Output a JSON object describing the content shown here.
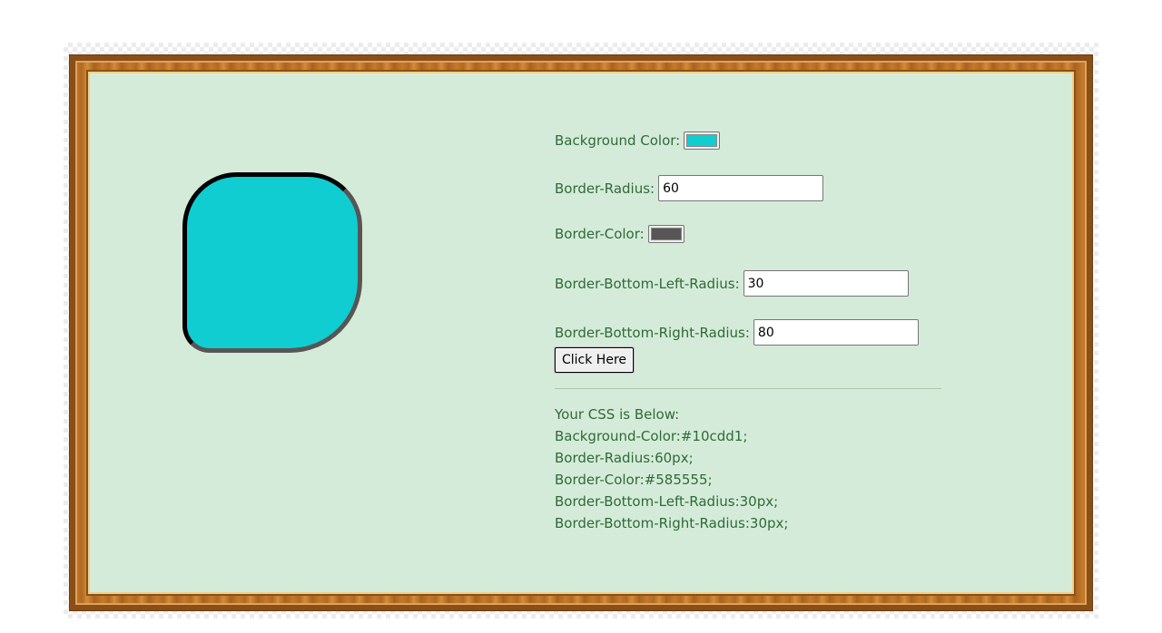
{
  "controls": {
    "background_color": {
      "label": "Background Color:",
      "value": "#10cdd1"
    },
    "border_radius": {
      "label": "Border-Radius:",
      "value": "60"
    },
    "border_color": {
      "label": "Border-Color:",
      "value": "#585555"
    },
    "border_bottom_left_radius": {
      "label": "Border-Bottom-Left-Radius:",
      "value": "30"
    },
    "border_bottom_right_radius": {
      "label": "Border-Bottom-Right-Radius:",
      "value": "80"
    },
    "submit_label": "Click Here"
  },
  "output": {
    "heading": "Your CSS is Below:",
    "lines": [
      "Background-Color:#10cdd1;",
      "Border-Radius:60px;",
      "Border-Color:#585555;",
      "Border-Bottom-Left-Radius:30px;",
      "Border-Bottom-Right-Radius:30px;"
    ]
  },
  "colors": {
    "panel_background": "#d5ebda",
    "text": "#2e6b35",
    "frame_wood": "#c47a2c"
  }
}
